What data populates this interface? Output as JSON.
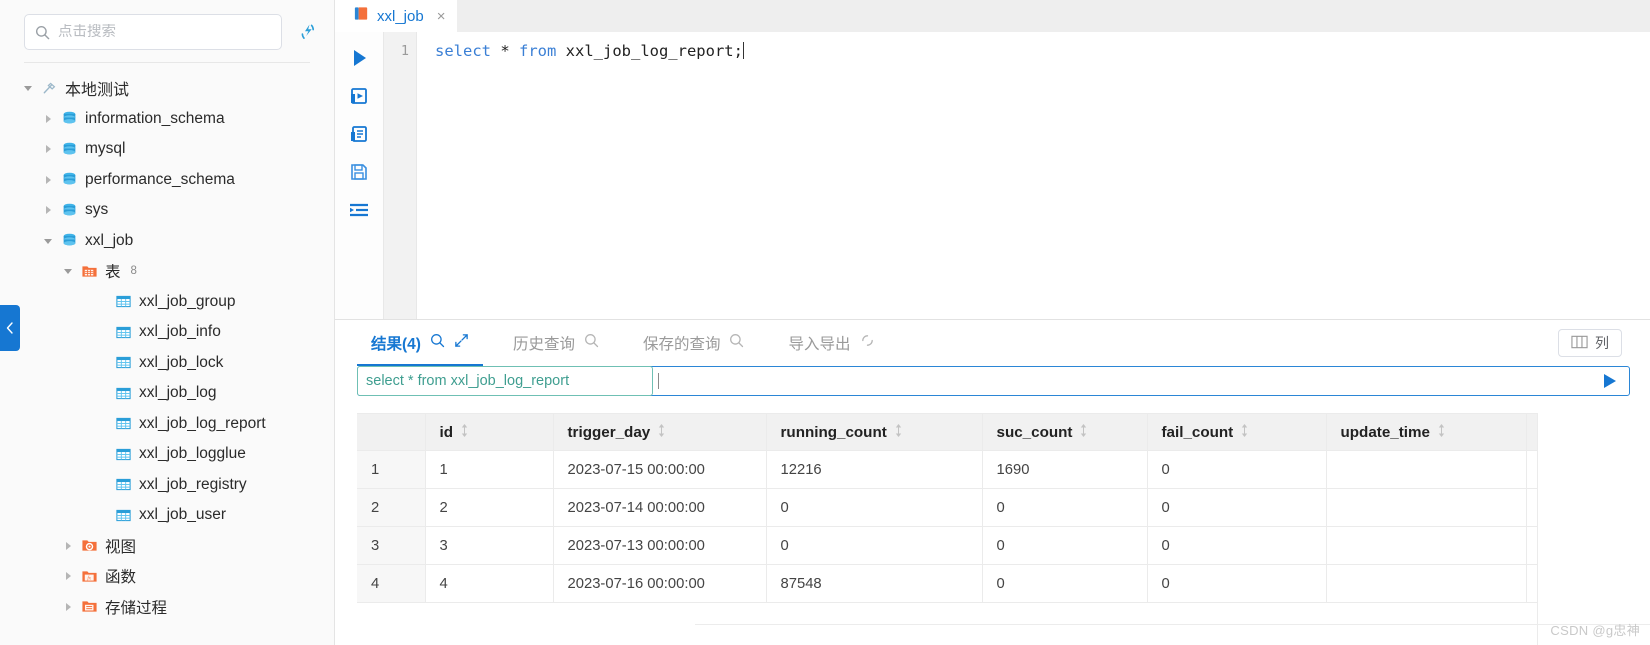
{
  "sidebar": {
    "search": {
      "placeholder": "点击搜索",
      "value": "",
      "icon": "search-icon"
    },
    "refresh_icon": "refresh-icon",
    "collapse_icon": "chevron-left-icon",
    "tree": [
      {
        "label": "本地测试",
        "level": 0,
        "icon": "connection-icon",
        "expanded": true,
        "count": ""
      },
      {
        "label": "information_schema",
        "level": 1,
        "icon": "database-icon",
        "expanded": false,
        "count": ""
      },
      {
        "label": "mysql",
        "level": 1,
        "icon": "database-icon",
        "expanded": false,
        "count": ""
      },
      {
        "label": "performance_schema",
        "level": 1,
        "icon": "database-icon",
        "expanded": false,
        "count": ""
      },
      {
        "label": "sys",
        "level": 1,
        "icon": "database-icon",
        "expanded": false,
        "count": ""
      },
      {
        "label": "xxl_job",
        "level": 1,
        "icon": "database-icon",
        "expanded": true,
        "count": ""
      },
      {
        "label": "表",
        "level": 2,
        "icon": "table-folder-icon",
        "expanded": true,
        "count": "8"
      },
      {
        "label": "xxl_job_group",
        "level": 3,
        "icon": "table-icon",
        "expanded": null,
        "count": ""
      },
      {
        "label": "xxl_job_info",
        "level": 3,
        "icon": "table-icon",
        "expanded": null,
        "count": ""
      },
      {
        "label": "xxl_job_lock",
        "level": 3,
        "icon": "table-icon",
        "expanded": null,
        "count": ""
      },
      {
        "label": "xxl_job_log",
        "level": 3,
        "icon": "table-icon",
        "expanded": null,
        "count": ""
      },
      {
        "label": "xxl_job_log_report",
        "level": 3,
        "icon": "table-icon",
        "expanded": null,
        "count": ""
      },
      {
        "label": "xxl_job_logglue",
        "level": 3,
        "icon": "table-icon",
        "expanded": null,
        "count": ""
      },
      {
        "label": "xxl_job_registry",
        "level": 3,
        "icon": "table-icon",
        "expanded": null,
        "count": ""
      },
      {
        "label": "xxl_job_user",
        "level": 3,
        "icon": "table-icon",
        "expanded": null,
        "count": ""
      },
      {
        "label": "视图",
        "level": 2,
        "icon": "view-folder-icon",
        "expanded": false,
        "count": ""
      },
      {
        "label": "函数",
        "level": 2,
        "icon": "function-folder-icon",
        "expanded": false,
        "count": ""
      },
      {
        "label": "存储过程",
        "level": 2,
        "icon": "procedure-folder-icon",
        "expanded": false,
        "count": ""
      }
    ]
  },
  "tabs": [
    {
      "label": "xxl_job",
      "icon": "console-icon",
      "close": "×",
      "active": true
    }
  ],
  "toolbar": {
    "buttons": [
      {
        "name": "run-button",
        "icon": "play-icon"
      },
      {
        "name": "run-to-file-button",
        "icon": "run-to-file-icon"
      },
      {
        "name": "explain-button",
        "icon": "script-icon"
      },
      {
        "name": "save-button",
        "icon": "floppy-icon"
      },
      {
        "name": "format-button",
        "icon": "format-icon"
      }
    ]
  },
  "editor": {
    "line_number": "1",
    "code_tokens": [
      {
        "text": "select",
        "type": "kw"
      },
      {
        "text": " * ",
        "type": "op"
      },
      {
        "text": "from",
        "type": "kw"
      },
      {
        "text": " xxl_job_log_report;",
        "type": "ident"
      }
    ],
    "code_plain": "select * from xxl_job_log_report;"
  },
  "results": {
    "tabs": [
      {
        "label": "结果(4)",
        "icon": "search-icon",
        "extra_icon": "expand-icon",
        "active": true
      },
      {
        "label": "历史查询",
        "icon": "search-icon",
        "extra_icon": "",
        "active": false
      },
      {
        "label": "保存的查询",
        "icon": "search-icon",
        "extra_icon": "",
        "active": false
      },
      {
        "label": "导入导出",
        "icon": "sync-icon",
        "extra_icon": "",
        "active": false
      }
    ],
    "columns_button": {
      "label": "列",
      "icon": "columns-icon"
    },
    "query_bar": {
      "chip": "select * from xxl_job_log_report",
      "input_value": "",
      "run_icon": "play-icon"
    },
    "grid": {
      "rownum_header": "",
      "columns": [
        {
          "key": "id",
          "label": "id",
          "sort_icon": "sort-icon"
        },
        {
          "key": "trigger_day",
          "label": "trigger_day",
          "sort_icon": "sort-icon"
        },
        {
          "key": "running_count",
          "label": "running_count",
          "sort_icon": "sort-icon"
        },
        {
          "key": "suc_count",
          "label": "suc_count",
          "sort_icon": "sort-icon"
        },
        {
          "key": "fail_count",
          "label": "fail_count",
          "sort_icon": "sort-icon"
        },
        {
          "key": "update_time",
          "label": "update_time",
          "sort_icon": "sort-icon"
        }
      ],
      "rows": [
        {
          "n": "1",
          "id": "1",
          "trigger_day": "2023-07-15 00:00:00",
          "running_count": "12216",
          "suc_count": "1690",
          "fail_count": "0",
          "update_time": ""
        },
        {
          "n": "2",
          "id": "2",
          "trigger_day": "2023-07-14 00:00:00",
          "running_count": "0",
          "suc_count": "0",
          "fail_count": "0",
          "update_time": ""
        },
        {
          "n": "3",
          "id": "3",
          "trigger_day": "2023-07-13 00:00:00",
          "running_count": "0",
          "suc_count": "0",
          "fail_count": "0",
          "update_time": ""
        },
        {
          "n": "4",
          "id": "4",
          "trigger_day": "2023-07-16 00:00:00",
          "running_count": "87548",
          "suc_count": "0",
          "fail_count": "0",
          "update_time": ""
        }
      ]
    }
  },
  "watermark": "CSDN @g忠神",
  "colors": {
    "accent": "#1677d2",
    "chip_green": "#3f9e90",
    "sidebar_bg": "#fafafa",
    "header_bg": "#f1f1f1",
    "db_icon": "#39a8dd",
    "folder_icon": "#f4703b"
  }
}
